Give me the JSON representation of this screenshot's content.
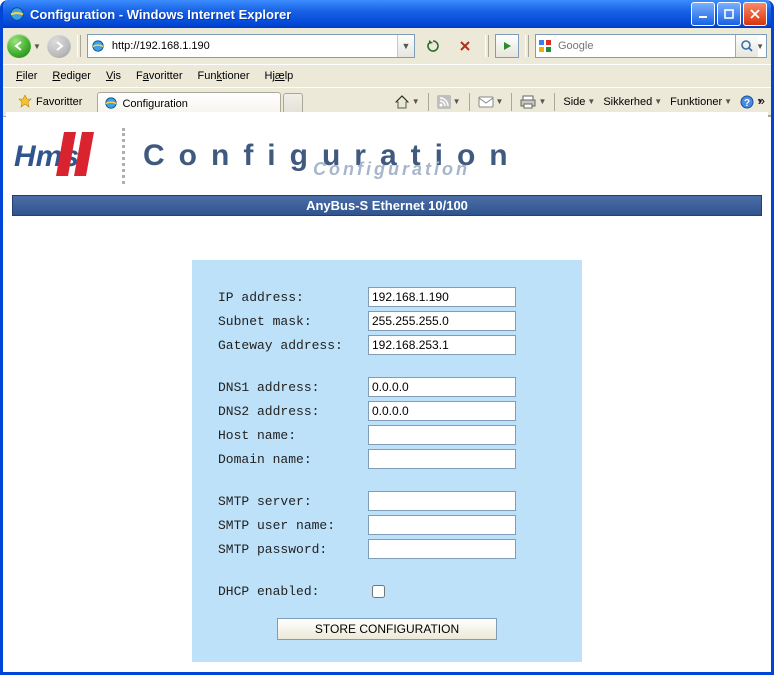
{
  "window": {
    "title": "Configuration - Windows Internet Explorer"
  },
  "address": {
    "url": "http://192.168.1.190"
  },
  "search": {
    "placeholder": "Google"
  },
  "menu": {
    "file": "Filer",
    "edit": "Rediger",
    "view": "Vis",
    "favorites": "Favoritter",
    "tools": "Funktioner",
    "help": "Hjælp"
  },
  "favbar": {
    "favorites": "Favoritter"
  },
  "tab": {
    "title": "Configuration"
  },
  "toolbar": {
    "page": "Side",
    "safety": "Sikkerhed",
    "tools": "Funktioner"
  },
  "brand": {
    "title": "Configuration",
    "subtitle": "Configuration"
  },
  "band": {
    "text": "AnyBus-S Ethernet 10/100"
  },
  "form": {
    "ip_label": "IP address:",
    "ip": "192.168.1.190",
    "mask_label": "Subnet mask:",
    "mask": "255.255.255.0",
    "gw_label": "Gateway address:",
    "gw": "192.168.253.1",
    "dns1_label": "DNS1 address:",
    "dns1": "0.0.0.0",
    "dns2_label": "DNS2 address:",
    "dns2": "0.0.0.0",
    "host_label": "Host name:",
    "host": "",
    "domain_label": "Domain name:",
    "domain": "",
    "smtp_label": "SMTP server:",
    "smtp": "",
    "smtp_user_label": "SMTP user name:",
    "smtp_user": "",
    "smtp_pass_label": "SMTP password:",
    "smtp_pass": "",
    "dhcp_label": "DHCP enabled:",
    "store": "STORE CONFIGURATION"
  }
}
